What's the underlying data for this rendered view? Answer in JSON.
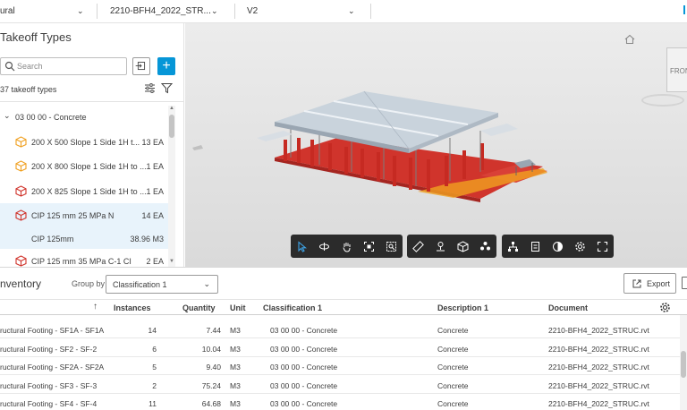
{
  "topbar": {
    "dropdowns": [
      {
        "label": "ural"
      },
      {
        "label": "2210-BFH4_2022_STR..."
      },
      {
        "label": "V2"
      }
    ]
  },
  "takeoff": {
    "title": "Takeoff Types",
    "search_placeholder": "Search",
    "add_label": "+",
    "count_text": "37 takeoff types",
    "group": {
      "label": "03 00 00 - Concrete"
    },
    "items": [
      {
        "name": "200 X 500 Slope 1 Side 1H t...",
        "qty": "13 EA",
        "icon_color": "#f0a020"
      },
      {
        "name": "200 X 800 Slope 1 Side 1H to ...",
        "qty": "1 EA",
        "icon_color": "#f0a020"
      },
      {
        "name": "200 X 825 Slope 1 Side 1H to ...",
        "qty": "1 EA",
        "icon_color": "#d0342c"
      },
      {
        "name": "CIP 125 mm 25 MPa N",
        "qty": "14 EA",
        "icon_color": "#d0342c"
      }
    ],
    "subitem": {
      "name": "CIP 125mm",
      "qty": "38.96 M3"
    },
    "partial_item": {
      "name": "CIP 125 mm 35 MPa C-1 CI",
      "qty": "2 EA",
      "icon_color": "#d0342c"
    }
  },
  "viewer": {
    "viewcube_label": "FRONT"
  },
  "inventory": {
    "title": "nventory",
    "group_by_label": "Group by",
    "group_by_value": "Classification 1",
    "export_label": "Export",
    "columns": {
      "instances": "Instances",
      "quantity": "Quantity",
      "unit": "Unit",
      "classification": "Classification 1",
      "description": "Description 1",
      "document": "Document",
      "sort_arrow": "↑"
    },
    "rows": [
      {
        "name": "ructural Footing - SF1A - SF1A",
        "instances": "14",
        "quantity": "7.44",
        "unit": "M3",
        "classification": "03 00 00 - Concrete",
        "description": "Concrete",
        "document": "2210-BFH4_2022_STRUC.rvt"
      },
      {
        "name": "ructural Footing - SF2 - SF-2",
        "instances": "6",
        "quantity": "10.04",
        "unit": "M3",
        "classification": "03 00 00 - Concrete",
        "description": "Concrete",
        "document": "2210-BFH4_2022_STRUC.rvt"
      },
      {
        "name": "ructural Footing - SF2A - SF2A",
        "instances": "5",
        "quantity": "9.40",
        "unit": "M3",
        "classification": "03 00 00 - Concrete",
        "description": "Concrete",
        "document": "2210-BFH4_2022_STRUC.rvt"
      },
      {
        "name": "ructural Footing - SF3 - SF-3",
        "instances": "2",
        "quantity": "75.24",
        "unit": "M3",
        "classification": "03 00 00 - Concrete",
        "description": "Concrete",
        "document": "2210-BFH4_2022_STRUC.rvt"
      },
      {
        "name": "ructural Footing - SF4 - SF-4",
        "instances": "11",
        "quantity": "64.68",
        "unit": "M3",
        "classification": "03 00 00 - Concrete",
        "description": "Concrete",
        "document": "2210-BFH4_2022_STRUC.rvt"
      }
    ]
  },
  "colors": {
    "accent": "#0696d7",
    "model_red": "#d0342c",
    "model_roof": "#c9d3dc",
    "toolbar_bg": "#2b2b2b"
  }
}
